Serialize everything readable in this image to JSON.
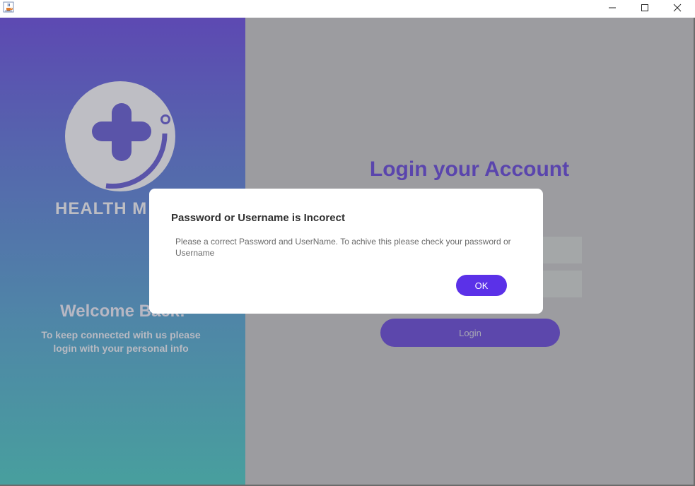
{
  "window": {
    "icon": "java-cup-icon",
    "controls": [
      "minimize-icon",
      "maximize-icon",
      "close-icon"
    ]
  },
  "left_panel": {
    "brand": "HEALTH M",
    "logo_icon": "medical-cross-logo-icon",
    "welcome_title": "Welcome Back!",
    "welcome_text": "To keep connected with us please login with your personal info",
    "gradient_colors": [
      "#5d49b2",
      "#489f9e"
    ]
  },
  "login_form": {
    "title": "Login your Account",
    "username_value": "",
    "password_value": "",
    "login_label": "Login",
    "accent_color": "#5a45ad"
  },
  "dialog": {
    "title": "Password or Username is Incorect",
    "message": "Please a correct Password and UserName. To achive this please check your password or Username",
    "ok_label": "OK",
    "ok_color": "#5b31e8"
  }
}
